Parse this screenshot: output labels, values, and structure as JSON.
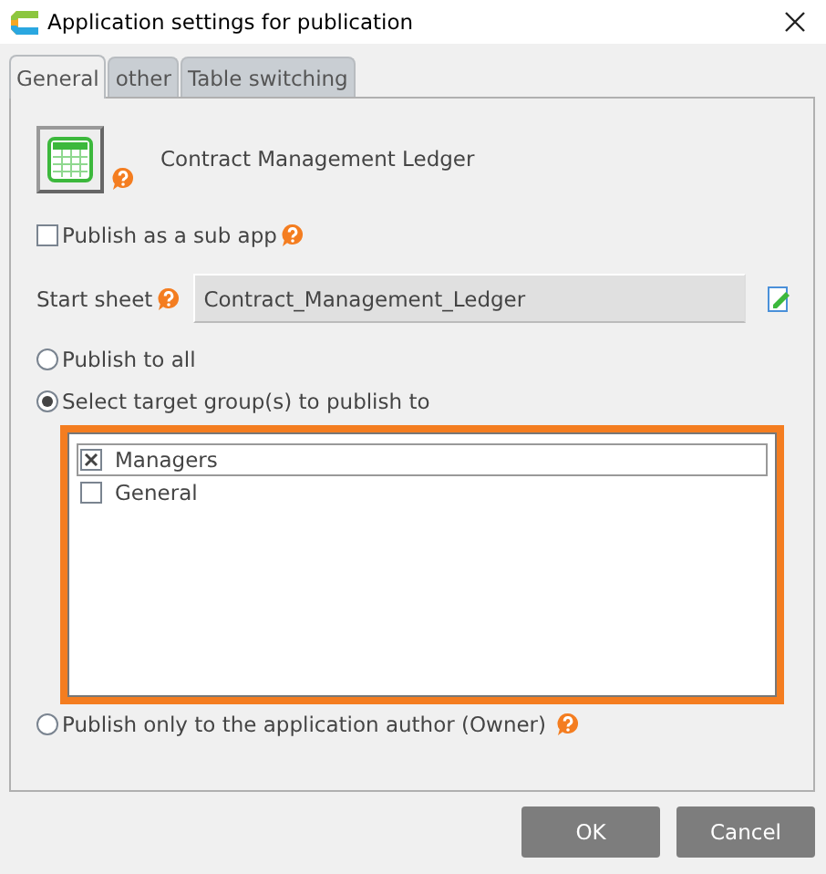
{
  "window": {
    "title": "Application settings for publication"
  },
  "tabs": [
    {
      "label": "General",
      "selected": true
    },
    {
      "label": "other",
      "selected": false
    },
    {
      "label": "Table switching",
      "selected": false
    }
  ],
  "app": {
    "name": "Contract Management Ledger"
  },
  "sub_app": {
    "label": "Publish as a sub app",
    "checked": false
  },
  "start_sheet": {
    "label": "Start sheet",
    "value": "Contract_Management_Ledger"
  },
  "publish_options": [
    {
      "label": "Publish to all",
      "selected": false,
      "help": false
    },
    {
      "label": "Select target group(s) to publish to",
      "selected": true,
      "help": false
    },
    {
      "label": "Publish only to the application author (Owner)",
      "selected": false,
      "help": true
    }
  ],
  "groups": [
    {
      "name": "Managers",
      "checked": true,
      "focused": true
    },
    {
      "name": "General",
      "checked": false,
      "focused": false
    }
  ],
  "buttons": [
    {
      "label": "OK"
    },
    {
      "label": "Cancel"
    }
  ]
}
